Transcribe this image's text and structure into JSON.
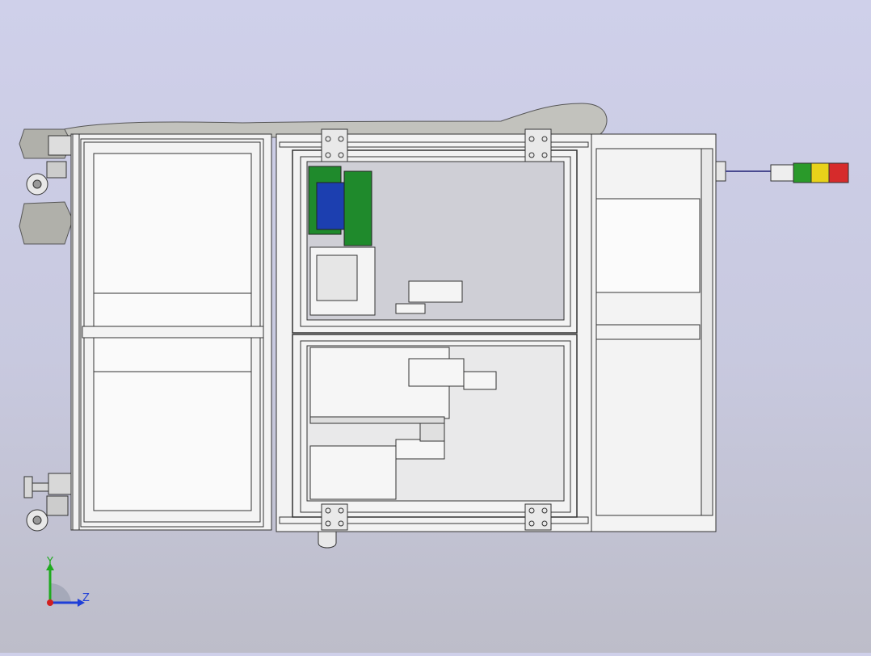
{
  "viewport": {
    "background_top": "#cfd0ea",
    "background_bottom": "#bdbdc9"
  },
  "model": {
    "frame_color": "#f2f2f2",
    "outline_color": "#303030",
    "mannequin_color": "#b9b9b4",
    "drum_green": "#1f8a2c",
    "drum_blue": "#1c3fb0",
    "stack_light_colors": [
      "#2a9a2a",
      "#e8d21a",
      "#d62b2b"
    ],
    "icons": [
      "caster-wheel-icon",
      "leveling-foot-icon",
      "hinge-bracket-icon",
      "stack-light-icon"
    ]
  },
  "triad": {
    "y_label": "Y",
    "z_label": "Z",
    "y_color": "#1faa1f",
    "z_color": "#1f3fd8",
    "x_color": "#d21f1f"
  }
}
